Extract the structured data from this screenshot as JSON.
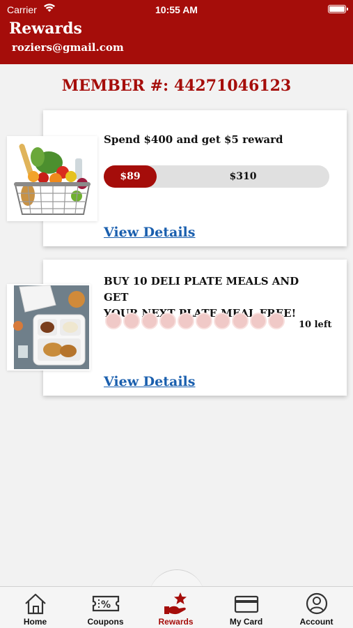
{
  "status": {
    "carrier": "Carrier",
    "time": "10:55 AM"
  },
  "header": {
    "title": "Rewards",
    "email": "roziers@gmail.com"
  },
  "member": {
    "label": "MEMBER #:",
    "number": "44271046123"
  },
  "offers": [
    {
      "title": "Spend $400 and get $5 reward",
      "progress_label": "$89",
      "progress_fraction": 0.2225,
      "remaining_label": "$310",
      "view_details": "View Details",
      "image_icon": "grocery-basket-image"
    },
    {
      "title_line1": "BUY 10 DELI PLATE MEALS AND GET",
      "title_line2": "YOUR NEXT PLATE MEAL FREE!",
      "punch_total": 10,
      "punch_filled": 0,
      "left_text": "10 left",
      "view_details": "View Details",
      "image_icon": "deli-plate-meal-image"
    }
  ],
  "tabs": [
    {
      "label": "Home",
      "icon": "home-icon"
    },
    {
      "label": "Coupons",
      "icon": "coupon-icon"
    },
    {
      "label": "Rewards",
      "icon": "rewards-icon"
    },
    {
      "label": "My Card",
      "icon": "card-icon"
    },
    {
      "label": "Account",
      "icon": "account-icon"
    }
  ],
  "colors": {
    "brand": "#a50d0a",
    "link": "#1a5fae",
    "punch": "#f0c9c7"
  }
}
